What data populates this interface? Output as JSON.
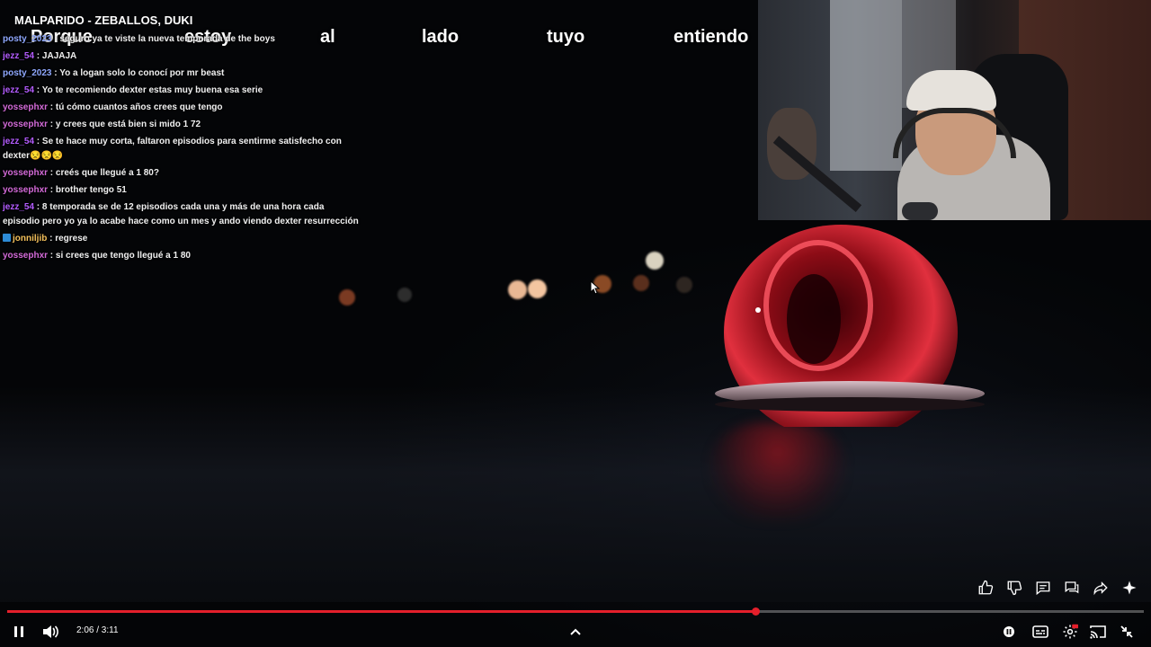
{
  "song": {
    "title": "MALPARIDO - ZEBALLOS, DUKI"
  },
  "lyrics": [
    "Porque",
    "estoy",
    "al",
    "lado",
    "tuyo",
    "entiendo"
  ],
  "chat": [
    {
      "user": "posty_2023",
      "user_color": "#8fa8ff",
      "text": "seguro ya te viste la nueva temporada de the boys"
    },
    {
      "user": "jezz_54",
      "user_color": "#b45cff",
      "text": "JAJAJA"
    },
    {
      "user": "posty_2023",
      "user_color": "#8fa8ff",
      "text": "Yo a logan solo lo conocí por mr beast"
    },
    {
      "user": "jezz_54",
      "user_color": "#b45cff",
      "text": "Yo te recomiendo dexter estas muy buena esa serie"
    },
    {
      "user": "yossephxr",
      "user_color": "#d36ad8",
      "text": "tú cómo cuantos años crees que tengo"
    },
    {
      "user": "yossephxr",
      "user_color": "#d36ad8",
      "text": "y crees que está bien si mido 1 72"
    },
    {
      "user": "jezz_54",
      "user_color": "#b45cff",
      "text": "Se te hace muy corta, faltaron episodios para sentirme satisfecho con dexter😒😒😒"
    },
    {
      "user": "yossephxr",
      "user_color": "#d36ad8",
      "text": "creés que llegué a 1 80?"
    },
    {
      "user": "yossephxr",
      "user_color": "#d36ad8",
      "text": "brother tengo 51"
    },
    {
      "user": "jezz_54",
      "user_color": "#b45cff",
      "text": "8 temporada se de 12 episodios cada una y más de una hora cada episodio pero yo ya lo acabe hace como un mes y ando viendo dexter resurrección"
    },
    {
      "user": "jonniljib",
      "user_color": "#f4c05a",
      "text": "regrese",
      "badge": true
    },
    {
      "user": "yossephxr",
      "user_color": "#d36ad8",
      "text": "si crees que tengo llegué a 1 80"
    }
  ],
  "player": {
    "time_current": "2:06",
    "time_total": "3:11",
    "time_display": "2:06 / 3:11",
    "progress_fraction": 0.658,
    "accent_color": "#e41f2b"
  },
  "actions": [
    "like-icon",
    "dislike-icon",
    "comment-icon",
    "chat-icon",
    "share-icon",
    "sparkle-icon"
  ],
  "controls": [
    "pause-icon",
    "volume-icon",
    "chevron-up-icon",
    "autoplay-toggle",
    "captions-icon",
    "settings-icon",
    "cast-icon",
    "exit-fullscreen-icon"
  ]
}
